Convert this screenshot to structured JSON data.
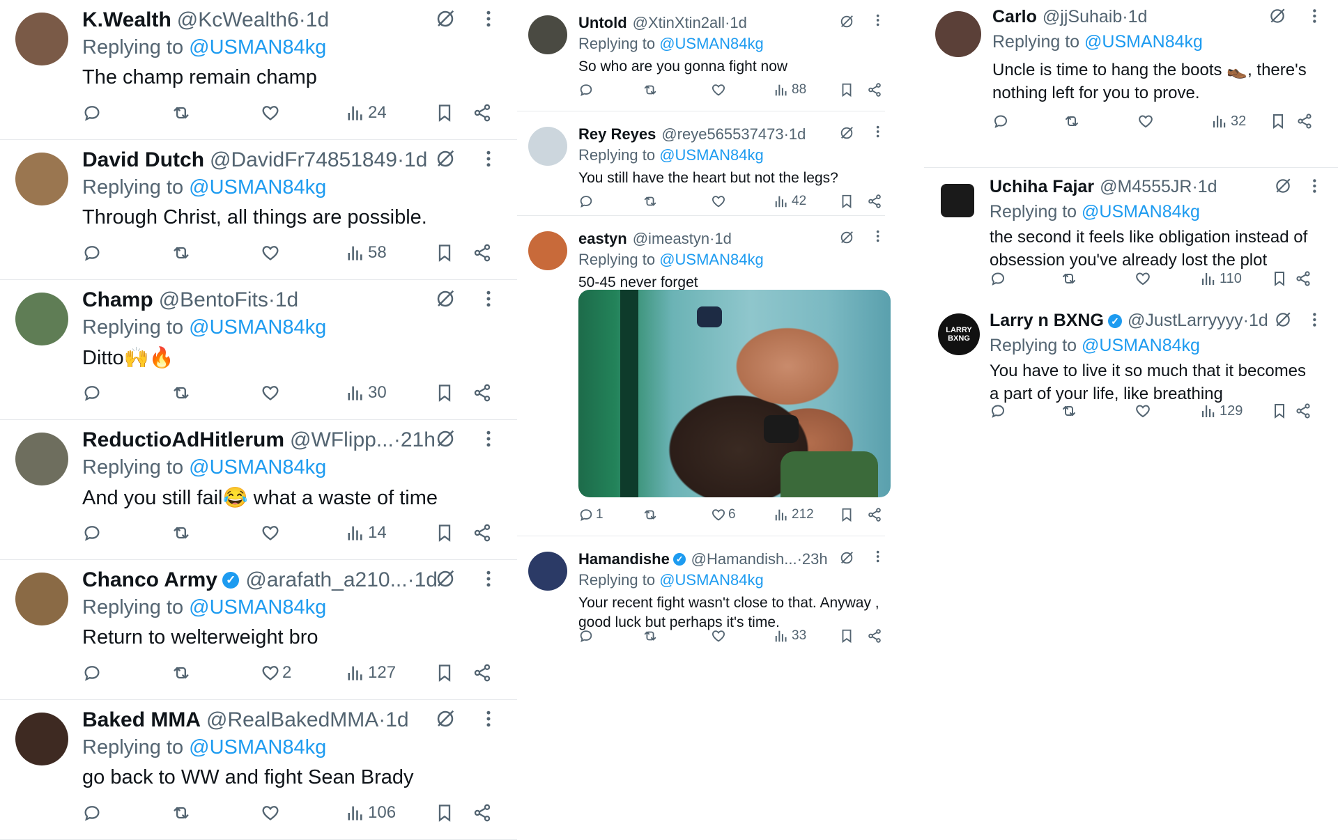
{
  "reply_prefix": "Replying to ",
  "replying_to": "@USMAN84kg",
  "column1": [
    {
      "name": "K.Wealth",
      "handle": "@KcWealth6",
      "sep": " · ",
      "time": "1d",
      "text": "The champ remain champ",
      "replies": "",
      "likes": "",
      "views": "24",
      "avatar_color": "#7a5a47"
    },
    {
      "name": "David Dutch",
      "handle": "@DavidFr74851849",
      "sep": " · ",
      "time": "1d",
      "text": "Through Christ, all things are possible.",
      "replies": "",
      "likes": "",
      "views": "58",
      "avatar_color": "#9a7650"
    },
    {
      "name": "Champ",
      "handle": "@BentoFits",
      "sep": " · ",
      "time": "1d",
      "text": "Ditto🙌🔥",
      "replies": "",
      "likes": "",
      "views": "30",
      "avatar_color": "#5f7d55"
    },
    {
      "name": "ReductioAdHitlerum",
      "handle": "@WFlipp...",
      "sep": " · ",
      "time": "21h",
      "text": "And you still fail😂 what a waste of time",
      "replies": "",
      "likes": "",
      "views": "14",
      "avatar_color": "#6e6e5e"
    },
    {
      "name": "Chanco Army",
      "verified": true,
      "handle": "@arafath_a210...",
      "sep": " · ",
      "time": "1d",
      "text": "Return to welterweight bro",
      "replies": "",
      "likes": "2",
      "views": "127",
      "avatar_color": "#8a6a45"
    },
    {
      "name": "Baked MMA",
      "handle": "@RealBakedMMA",
      "sep": " · ",
      "time": "1d",
      "text": "go back to WW and fight Sean Brady",
      "replies": "",
      "likes": "",
      "views": "106",
      "avatar_color": "#3e2a22"
    }
  ],
  "column2": [
    {
      "name": "Untold",
      "handle": "@XtinXtin2all",
      "sep": " · ",
      "time": "1d",
      "text": "So who are you gonna fight now",
      "replies": "",
      "likes": "",
      "views": "88",
      "avatar_color": "#4a4a42"
    },
    {
      "name": "Rey Reyes",
      "handle": "@reye565537473",
      "sep": " · ",
      "time": "1d",
      "text": "You still have the heart but not the legs?",
      "replies": "",
      "likes": "",
      "views": "42",
      "avatar_color": "#ccd6dd"
    },
    {
      "name": "eastyn",
      "handle": "@imeastyn",
      "sep": " · ",
      "time": "1d",
      "text": "50-45 never forget",
      "replies": "1",
      "likes": "6",
      "views": "212",
      "avatar_color": "#c86a3a"
    },
    {
      "name": "Hamandishe",
      "verified": true,
      "handle": "@Hamandish...",
      "sep": " · ",
      "time": "23h",
      "text": "Your recent fight wasn't close to that. Anyway , good luck but perhaps it's time.",
      "replies": "",
      "likes": "",
      "views": "33",
      "avatar_color": "#2b3a66"
    }
  ],
  "column3": [
    {
      "name": "Carlo",
      "handle": "@jjSuhaib",
      "sep": " · ",
      "time": "1d",
      "text": "Uncle is time to hang the boots 👞, there's nothing left for you to prove.",
      "replies": "",
      "likes": "",
      "views": "32",
      "avatar_color": "#5b4038"
    },
    {
      "name": "Uchiha Fajar",
      "handle": "@M4555JR",
      "sep": " · ",
      "time": "1d",
      "text": "the second it feels like obligation instead of obsession you've already lost the plot",
      "replies": "",
      "likes": "",
      "views": "110",
      "avatar_color": "#1a1a1a"
    },
    {
      "name": "Larry n BXNG",
      "verified": true,
      "handle": "@JustLarryyyy",
      "sep": " · ",
      "time": "1d",
      "text": "You have to live it so much that it becomes a part of your life, like breathing",
      "replies": "",
      "likes": "",
      "views": "129",
      "avatar_color": "#111111",
      "avatar_text": "LARRY BXNG"
    }
  ],
  "icons": {
    "grok": "grok-icon",
    "more": "more-icon",
    "reply": "reply-icon",
    "repost": "repost-icon",
    "like": "like-icon",
    "views": "views-icon",
    "bookmark": "bookmark-icon",
    "share": "share-icon"
  }
}
